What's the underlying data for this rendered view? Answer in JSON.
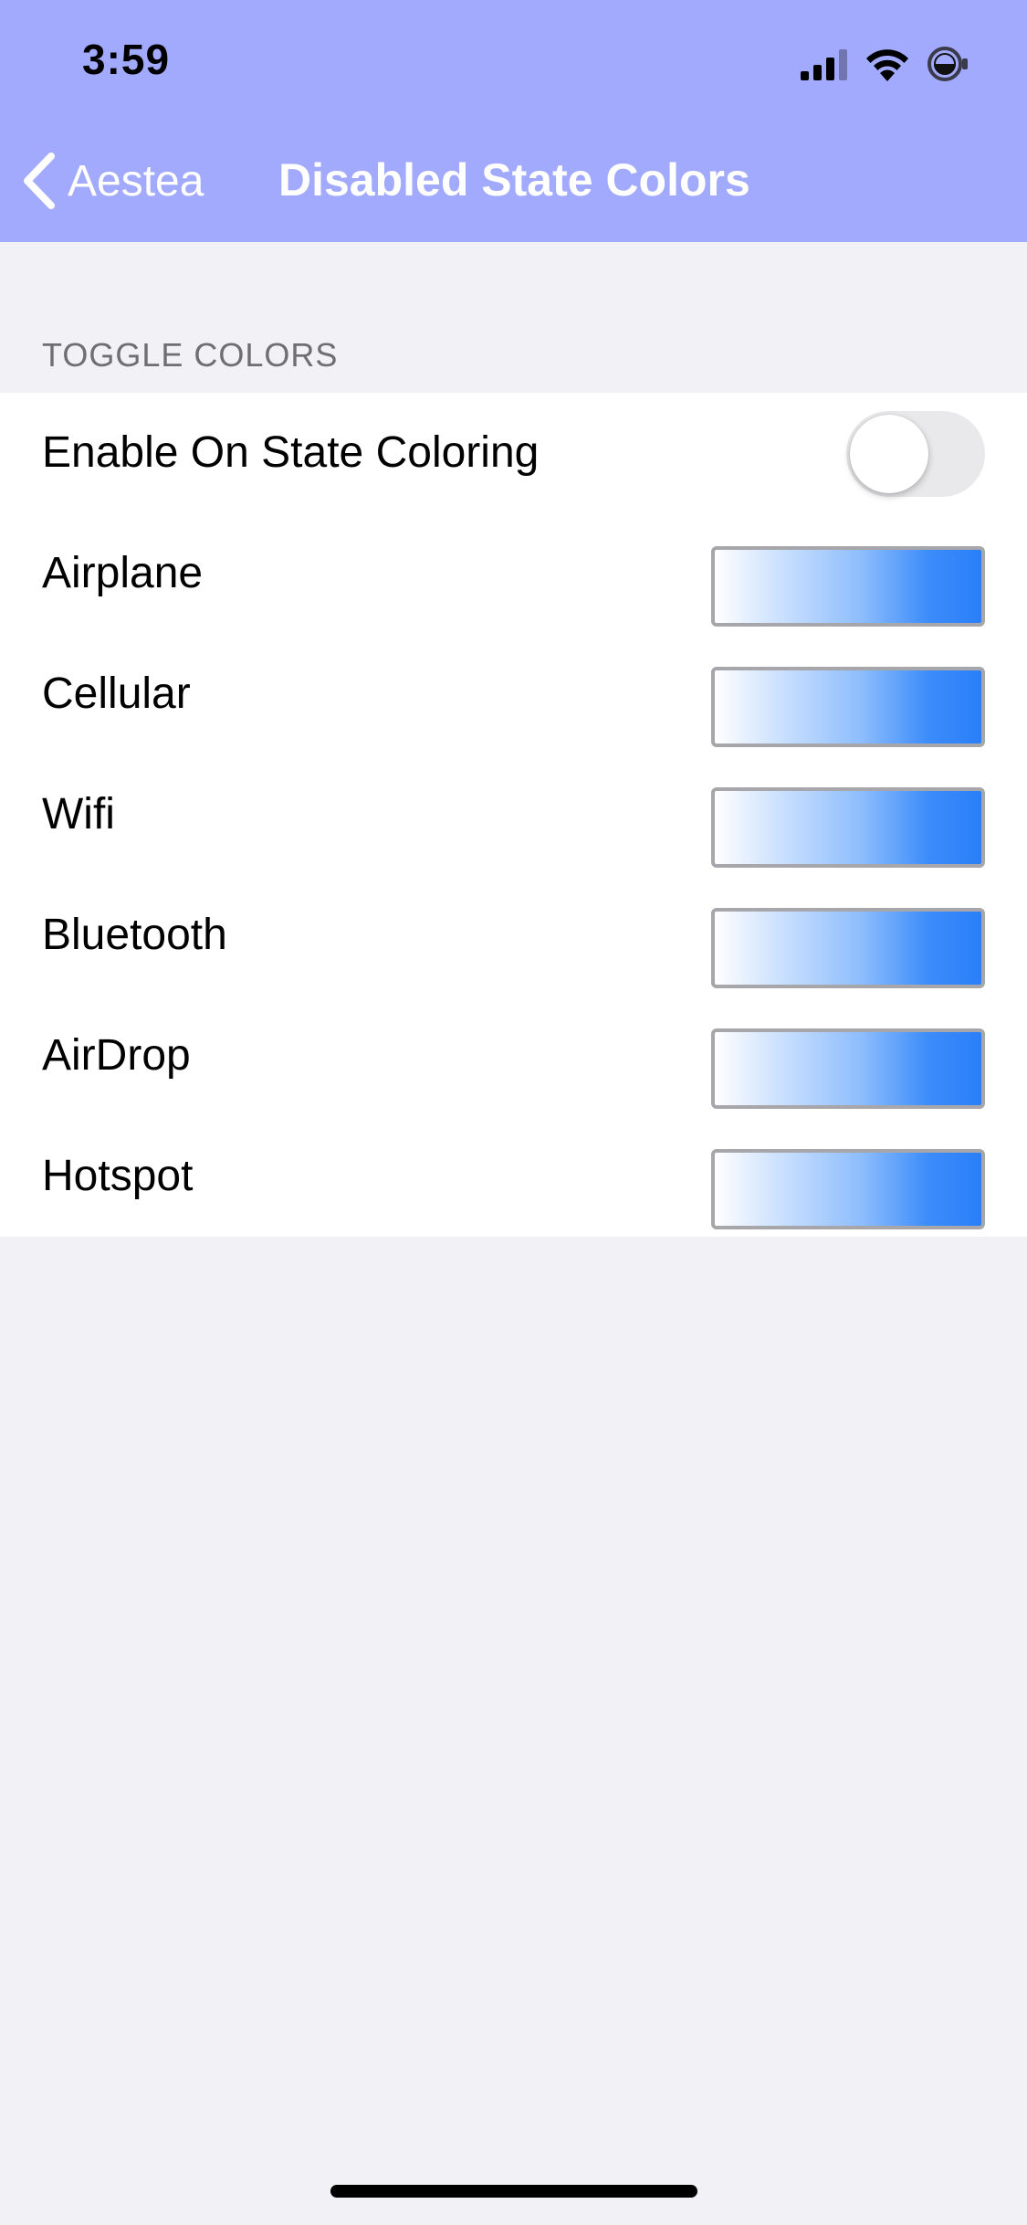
{
  "status_bar": {
    "time": "3:59",
    "icons": [
      "signal-icon",
      "wifi-icon",
      "battery-icon"
    ]
  },
  "nav": {
    "back_label": "Aestea",
    "title": "Disabled State Colors"
  },
  "section": {
    "header": "TOGGLE COLORS"
  },
  "rows": [
    {
      "label": "Enable On State Coloring",
      "type": "toggle",
      "on": false
    },
    {
      "label": "Airplane",
      "type": "color"
    },
    {
      "label": "Cellular",
      "type": "color"
    },
    {
      "label": "Wifi",
      "type": "color"
    },
    {
      "label": "Bluetooth",
      "type": "color"
    },
    {
      "label": "AirDrop",
      "type": "color"
    },
    {
      "label": "Hotspot",
      "type": "color"
    }
  ],
  "colors": {
    "header_background": "#a2aafe",
    "page_background": "#f1f1f6",
    "swatch_gradient_start": "#ffffff",
    "swatch_gradient_end": "#2a7ff8",
    "toggle_off": "#e9e9eb"
  }
}
